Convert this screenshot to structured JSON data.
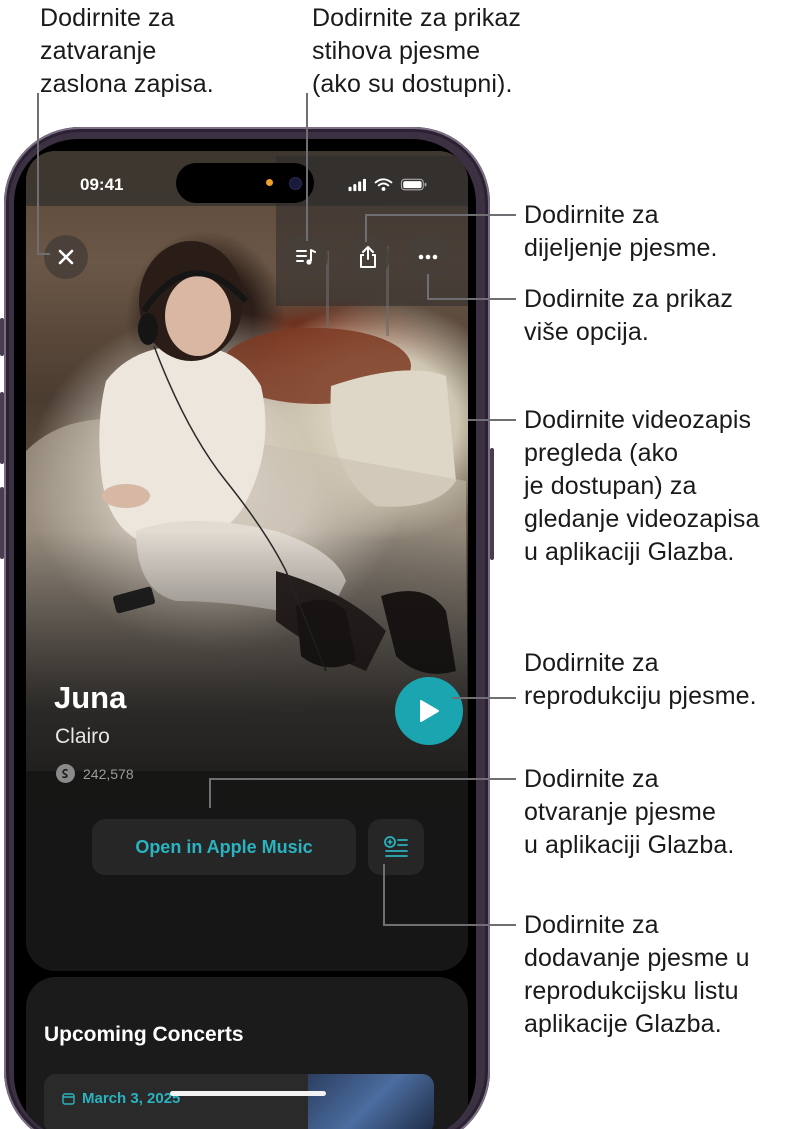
{
  "callouts": {
    "close": "Dodirnite za\nzatvaranje\nzaslona zapisa.",
    "lyrics": "Dodirnite za prikaz\nstihova pjesme\n(ako su dostupni).",
    "share": "Dodirnite za\ndijeljenje pjesme.",
    "more": "Dodirnite za prikaz\nviše opcija.",
    "video": "Dodirnite videozapis\npregleda (ako\nje dostupan) za\ngledanje videozapisa\nu aplikaciji Glazba.",
    "play": "Dodirnite za\nreprodukciju pjesme.",
    "open": "Dodirnite za\notvaranje pjesme\nu aplikaciji Glazba.",
    "add": "Dodirnite za\ndodavanje pjesme u\nreprodukcijsku listu\naplikacije Glazba."
  },
  "status_bar": {
    "time": "09:41"
  },
  "icons": {
    "close": "close-icon",
    "lyrics": "lyrics-icon",
    "share": "share-icon",
    "more": "ellipsis-icon",
    "play": "play-icon",
    "add_to_playlist": "add-to-playlist-icon",
    "shazam": "shazam-icon",
    "calendar": "calendar-icon"
  },
  "song": {
    "title": "Juna",
    "artist": "Clairo",
    "shazam_count": "242,578"
  },
  "actions": {
    "open_in_music": "Open in Apple Music"
  },
  "concerts": {
    "heading": "Upcoming Concerts",
    "items": [
      {
        "date": "March 3, 2025"
      }
    ]
  },
  "colors": {
    "accent": "#1aa5b0",
    "frame": "#3c3142"
  }
}
